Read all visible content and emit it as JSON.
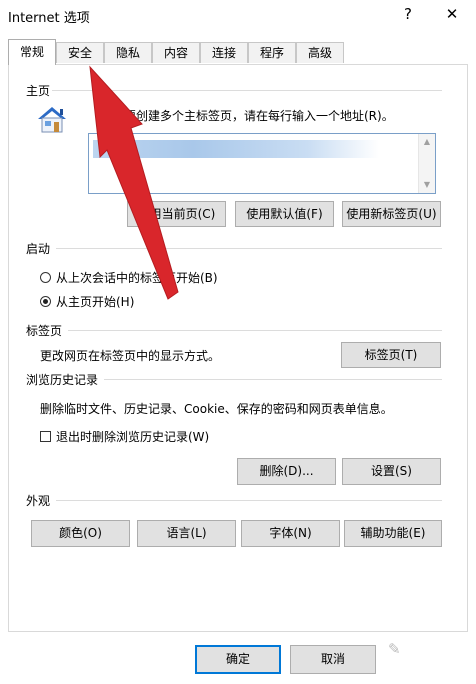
{
  "window": {
    "title": "Internet 选项",
    "help_label": "?",
    "close_label": "✕"
  },
  "tabs": [
    {
      "label": "常规",
      "active": true
    },
    {
      "label": "安全"
    },
    {
      "label": "隐私"
    },
    {
      "label": "内容"
    },
    {
      "label": "连接"
    },
    {
      "label": "程序"
    },
    {
      "label": "高级"
    }
  ],
  "home": {
    "label": "主页",
    "description": "若要创建多个主标签页，请在每行输入一个地址(R)。",
    "url": "",
    "buttons": {
      "use_current": "使用当前页(C)",
      "use_default": "使用默认值(F)",
      "use_new_tab": "使用新标签页(U)"
    }
  },
  "startup": {
    "label": "启动",
    "options": [
      {
        "label": "从上次会话中的标签页开始(B)",
        "checked": false
      },
      {
        "label": "从主页开始(H)",
        "checked": true
      }
    ]
  },
  "tabs_group": {
    "label": "标签页",
    "description": "更改网页在标签页中的显示方式。",
    "button": "标签页(T)"
  },
  "history": {
    "label": "浏览历史记录",
    "description": "删除临时文件、历史记录、Cookie、保存的密码和网页表单信息。",
    "checkbox": "退出时删除浏览历史记录(W)",
    "checkbox_checked": false,
    "delete_button": "删除(D)...",
    "settings_button": "设置(S)"
  },
  "appearance": {
    "label": "外观",
    "buttons": [
      "颜色(O)",
      "语言(L)",
      "字体(N)",
      "辅助功能(E)"
    ]
  },
  "footer": {
    "ok": "确定",
    "cancel": "取消"
  },
  "icons": {
    "house": "house-icon",
    "overlay": "red-arrow-annotation"
  },
  "colors": {
    "accent": "#0078d7",
    "arrow": "#d9262b",
    "house_roof": "#2c6bc6"
  }
}
